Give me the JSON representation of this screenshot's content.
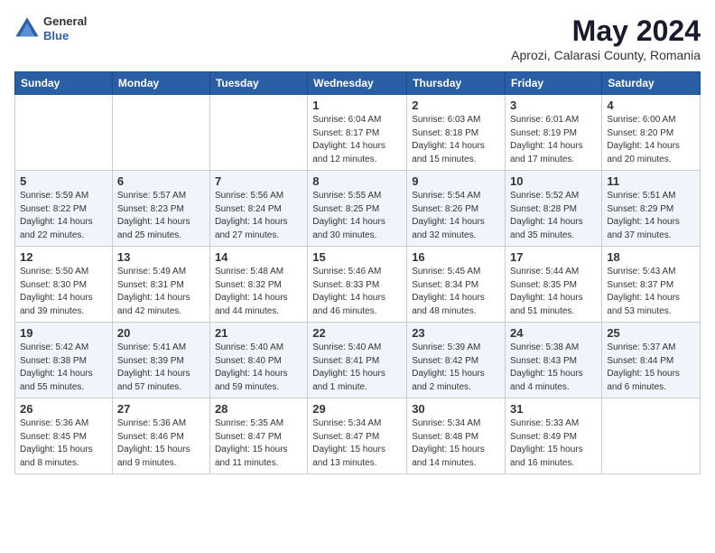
{
  "header": {
    "logo": {
      "general": "General",
      "blue": "Blue"
    },
    "month": "May 2024",
    "location": "Aprozi, Calarasi County, Romania"
  },
  "weekdays": [
    "Sunday",
    "Monday",
    "Tuesday",
    "Wednesday",
    "Thursday",
    "Friday",
    "Saturday"
  ],
  "weeks": [
    [
      {
        "day": "",
        "info": ""
      },
      {
        "day": "",
        "info": ""
      },
      {
        "day": "",
        "info": ""
      },
      {
        "day": "1",
        "info": "Sunrise: 6:04 AM\nSunset: 8:17 PM\nDaylight: 14 hours\nand 12 minutes."
      },
      {
        "day": "2",
        "info": "Sunrise: 6:03 AM\nSunset: 8:18 PM\nDaylight: 14 hours\nand 15 minutes."
      },
      {
        "day": "3",
        "info": "Sunrise: 6:01 AM\nSunset: 8:19 PM\nDaylight: 14 hours\nand 17 minutes."
      },
      {
        "day": "4",
        "info": "Sunrise: 6:00 AM\nSunset: 8:20 PM\nDaylight: 14 hours\nand 20 minutes."
      }
    ],
    [
      {
        "day": "5",
        "info": "Sunrise: 5:59 AM\nSunset: 8:22 PM\nDaylight: 14 hours\nand 22 minutes."
      },
      {
        "day": "6",
        "info": "Sunrise: 5:57 AM\nSunset: 8:23 PM\nDaylight: 14 hours\nand 25 minutes."
      },
      {
        "day": "7",
        "info": "Sunrise: 5:56 AM\nSunset: 8:24 PM\nDaylight: 14 hours\nand 27 minutes."
      },
      {
        "day": "8",
        "info": "Sunrise: 5:55 AM\nSunset: 8:25 PM\nDaylight: 14 hours\nand 30 minutes."
      },
      {
        "day": "9",
        "info": "Sunrise: 5:54 AM\nSunset: 8:26 PM\nDaylight: 14 hours\nand 32 minutes."
      },
      {
        "day": "10",
        "info": "Sunrise: 5:52 AM\nSunset: 8:28 PM\nDaylight: 14 hours\nand 35 minutes."
      },
      {
        "day": "11",
        "info": "Sunrise: 5:51 AM\nSunset: 8:29 PM\nDaylight: 14 hours\nand 37 minutes."
      }
    ],
    [
      {
        "day": "12",
        "info": "Sunrise: 5:50 AM\nSunset: 8:30 PM\nDaylight: 14 hours\nand 39 minutes."
      },
      {
        "day": "13",
        "info": "Sunrise: 5:49 AM\nSunset: 8:31 PM\nDaylight: 14 hours\nand 42 minutes."
      },
      {
        "day": "14",
        "info": "Sunrise: 5:48 AM\nSunset: 8:32 PM\nDaylight: 14 hours\nand 44 minutes."
      },
      {
        "day": "15",
        "info": "Sunrise: 5:46 AM\nSunset: 8:33 PM\nDaylight: 14 hours\nand 46 minutes."
      },
      {
        "day": "16",
        "info": "Sunrise: 5:45 AM\nSunset: 8:34 PM\nDaylight: 14 hours\nand 48 minutes."
      },
      {
        "day": "17",
        "info": "Sunrise: 5:44 AM\nSunset: 8:35 PM\nDaylight: 14 hours\nand 51 minutes."
      },
      {
        "day": "18",
        "info": "Sunrise: 5:43 AM\nSunset: 8:37 PM\nDaylight: 14 hours\nand 53 minutes."
      }
    ],
    [
      {
        "day": "19",
        "info": "Sunrise: 5:42 AM\nSunset: 8:38 PM\nDaylight: 14 hours\nand 55 minutes."
      },
      {
        "day": "20",
        "info": "Sunrise: 5:41 AM\nSunset: 8:39 PM\nDaylight: 14 hours\nand 57 minutes."
      },
      {
        "day": "21",
        "info": "Sunrise: 5:40 AM\nSunset: 8:40 PM\nDaylight: 14 hours\nand 59 minutes."
      },
      {
        "day": "22",
        "info": "Sunrise: 5:40 AM\nSunset: 8:41 PM\nDaylight: 15 hours\nand 1 minute."
      },
      {
        "day": "23",
        "info": "Sunrise: 5:39 AM\nSunset: 8:42 PM\nDaylight: 15 hours\nand 2 minutes."
      },
      {
        "day": "24",
        "info": "Sunrise: 5:38 AM\nSunset: 8:43 PM\nDaylight: 15 hours\nand 4 minutes."
      },
      {
        "day": "25",
        "info": "Sunrise: 5:37 AM\nSunset: 8:44 PM\nDaylight: 15 hours\nand 6 minutes."
      }
    ],
    [
      {
        "day": "26",
        "info": "Sunrise: 5:36 AM\nSunset: 8:45 PM\nDaylight: 15 hours\nand 8 minutes."
      },
      {
        "day": "27",
        "info": "Sunrise: 5:36 AM\nSunset: 8:46 PM\nDaylight: 15 hours\nand 9 minutes."
      },
      {
        "day": "28",
        "info": "Sunrise: 5:35 AM\nSunset: 8:47 PM\nDaylight: 15 hours\nand 11 minutes."
      },
      {
        "day": "29",
        "info": "Sunrise: 5:34 AM\nSunset: 8:47 PM\nDaylight: 15 hours\nand 13 minutes."
      },
      {
        "day": "30",
        "info": "Sunrise: 5:34 AM\nSunset: 8:48 PM\nDaylight: 15 hours\nand 14 minutes."
      },
      {
        "day": "31",
        "info": "Sunrise: 5:33 AM\nSunset: 8:49 PM\nDaylight: 15 hours\nand 16 minutes."
      },
      {
        "day": "",
        "info": ""
      }
    ]
  ]
}
